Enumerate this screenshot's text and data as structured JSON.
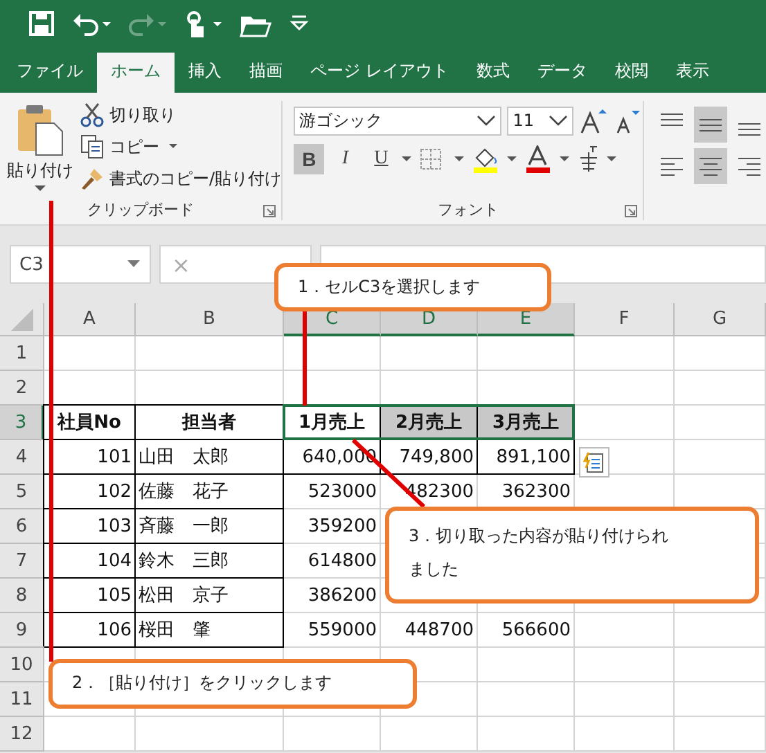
{
  "quick_access": [
    {
      "kind": "save",
      "disabled": false
    },
    {
      "kind": "undo",
      "disabled": false
    },
    {
      "kind": "redo",
      "disabled": true
    },
    {
      "kind": "touch",
      "disabled": false
    },
    {
      "kind": "open",
      "disabled": false
    },
    {
      "kind": "customize",
      "disabled": false
    }
  ],
  "tabs": [
    {
      "label": "ファイル",
      "selected": false
    },
    {
      "label": "ホーム",
      "selected": true
    },
    {
      "label": "挿入",
      "selected": false
    },
    {
      "label": "描画",
      "selected": false
    },
    {
      "label": "ページ レイアウト",
      "selected": false
    },
    {
      "label": "数式",
      "selected": false
    },
    {
      "label": "データ",
      "selected": false
    },
    {
      "label": "校閲",
      "selected": false
    },
    {
      "label": "表示",
      "selected": false
    }
  ],
  "clipboard": {
    "paste": "貼り付け",
    "cut": "切り取り",
    "copy": "コピー",
    "format_painter": "書式のコピー/貼り付け",
    "label": "クリップボード"
  },
  "font": {
    "font_name": "游ゴシック",
    "font_size": "11",
    "label": "フォント",
    "format_buttons": [
      {
        "label": "B",
        "selected": true
      },
      {
        "label": "I",
        "selected": false
      },
      {
        "label": "U",
        "selected": false
      }
    ]
  },
  "alignment": [
    {
      "kind": "top",
      "selected": false
    },
    {
      "kind": "middle",
      "selected": true
    },
    {
      "kind": "bottom",
      "selected": false
    },
    {
      "kind": "left",
      "selected": false
    },
    {
      "kind": "center",
      "selected": true
    },
    {
      "kind": "right",
      "selected": false
    }
  ],
  "formula_bar": {
    "name_box": "C3",
    "cancel": "×"
  },
  "sheet": {
    "columns": [
      {
        "label": "A",
        "selected": false
      },
      {
        "label": "B",
        "selected": false
      },
      {
        "label": "C",
        "selected": true
      },
      {
        "label": "D",
        "selected": true
      },
      {
        "label": "E",
        "selected": true
      },
      {
        "label": "F",
        "selected": false
      },
      {
        "label": "G",
        "selected": false
      }
    ],
    "rows": [
      {
        "label": "1",
        "selected": false
      },
      {
        "label": "2",
        "selected": false
      },
      {
        "label": "3",
        "selected": true,
        "cells": [
          {
            "text": "社員No",
            "kind": "heading",
            "boxed": true,
            "shaded": false,
            "selected": false
          },
          {
            "text": "担当者",
            "kind": "heading",
            "boxed": true,
            "shaded": false,
            "selected": false
          },
          {
            "text": "1月売上",
            "kind": "heading",
            "boxed": true,
            "shaded": false,
            "selected": true
          },
          {
            "text": "2月売上",
            "kind": "heading",
            "boxed": true,
            "shaded": true,
            "selected": true
          },
          {
            "text": "3月売上",
            "kind": "heading",
            "boxed": true,
            "shaded": true,
            "selected": true
          }
        ]
      },
      {
        "label": "4",
        "selected": false,
        "cells": [
          {
            "text": "101",
            "kind": "number",
            "boxed": true
          },
          {
            "text": "山田　太郎",
            "kind": "text",
            "boxed": true
          },
          {
            "text": "640,000",
            "kind": "number",
            "boxed": true
          },
          {
            "text": "749,800",
            "kind": "number",
            "boxed": true
          },
          {
            "text": "891,100",
            "kind": "number",
            "boxed": true
          }
        ]
      },
      {
        "label": "5",
        "selected": false,
        "cells": [
          {
            "text": "102",
            "kind": "number",
            "boxed": true
          },
          {
            "text": "佐藤　花子",
            "kind": "text",
            "boxed": true
          },
          {
            "text": "523000",
            "kind": "number",
            "boxed": false
          },
          {
            "text": "482300",
            "kind": "number",
            "boxed": false
          },
          {
            "text": "362300",
            "kind": "number",
            "boxed": false
          }
        ]
      },
      {
        "label": "6",
        "selected": false,
        "cells": [
          {
            "text": "103",
            "kind": "number",
            "boxed": true
          },
          {
            "text": "斉藤　一郎",
            "kind": "text",
            "boxed": true
          },
          {
            "text": "359200",
            "kind": "number",
            "boxed": false
          }
        ]
      },
      {
        "label": "7",
        "selected": false,
        "cells": [
          {
            "text": "104",
            "kind": "number",
            "boxed": true
          },
          {
            "text": "鈴木　三郎",
            "kind": "text",
            "boxed": true
          },
          {
            "text": "614800",
            "kind": "number",
            "boxed": false
          }
        ]
      },
      {
        "label": "8",
        "selected": false,
        "cells": [
          {
            "text": "105",
            "kind": "number",
            "boxed": true
          },
          {
            "text": "松田　京子",
            "kind": "text",
            "boxed": true
          },
          {
            "text": "386200",
            "kind": "number",
            "boxed": false
          }
        ]
      },
      {
        "label": "9",
        "selected": false,
        "cells": [
          {
            "text": "106",
            "kind": "number",
            "boxed": true
          },
          {
            "text": "桜田　肇",
            "kind": "text",
            "boxed": true
          },
          {
            "text": "559000",
            "kind": "number",
            "boxed": false
          },
          {
            "text": "448700",
            "kind": "number",
            "boxed": false
          },
          {
            "text": "566600",
            "kind": "number",
            "boxed": false
          }
        ]
      },
      {
        "label": "10",
        "selected": false
      },
      {
        "label": "11",
        "selected": false
      },
      {
        "label": "12",
        "selected": false
      }
    ]
  },
  "callouts": [
    {
      "text": "1．セルC3を選択します"
    },
    {
      "text": "2．［貼り付け］をクリックします"
    },
    {
      "text": "3．切り取った内容が貼り付けられました"
    }
  ]
}
